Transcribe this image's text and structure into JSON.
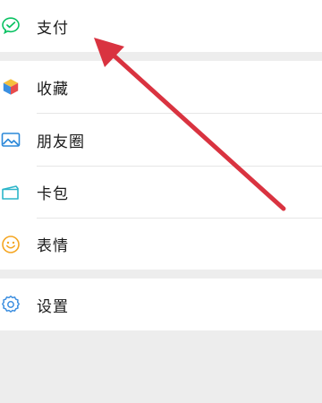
{
  "menu": {
    "pay": {
      "label": "支付",
      "icon": "wechat-pay-icon"
    },
    "favorites": {
      "label": "收藏",
      "icon": "favorites-cube-icon"
    },
    "moments": {
      "label": "朋友圈",
      "icon": "moments-picture-icon"
    },
    "cards": {
      "label": "卡包",
      "icon": "card-wallet-icon"
    },
    "stickers": {
      "label": "表情",
      "icon": "smiley-icon"
    },
    "settings": {
      "label": "设置",
      "icon": "gear-icon"
    }
  },
  "colors": {
    "background": "#ededed",
    "row_background": "#ffffff",
    "divider": "#e6e6e6",
    "pay_green": "#07c160",
    "moments_blue": "#2b88d9",
    "settings_blue": "#3d8fe0",
    "stickers_orange": "#f5a623",
    "arrow_red": "#d93340"
  },
  "annotation": {
    "type": "arrow",
    "points_to": "pay"
  }
}
